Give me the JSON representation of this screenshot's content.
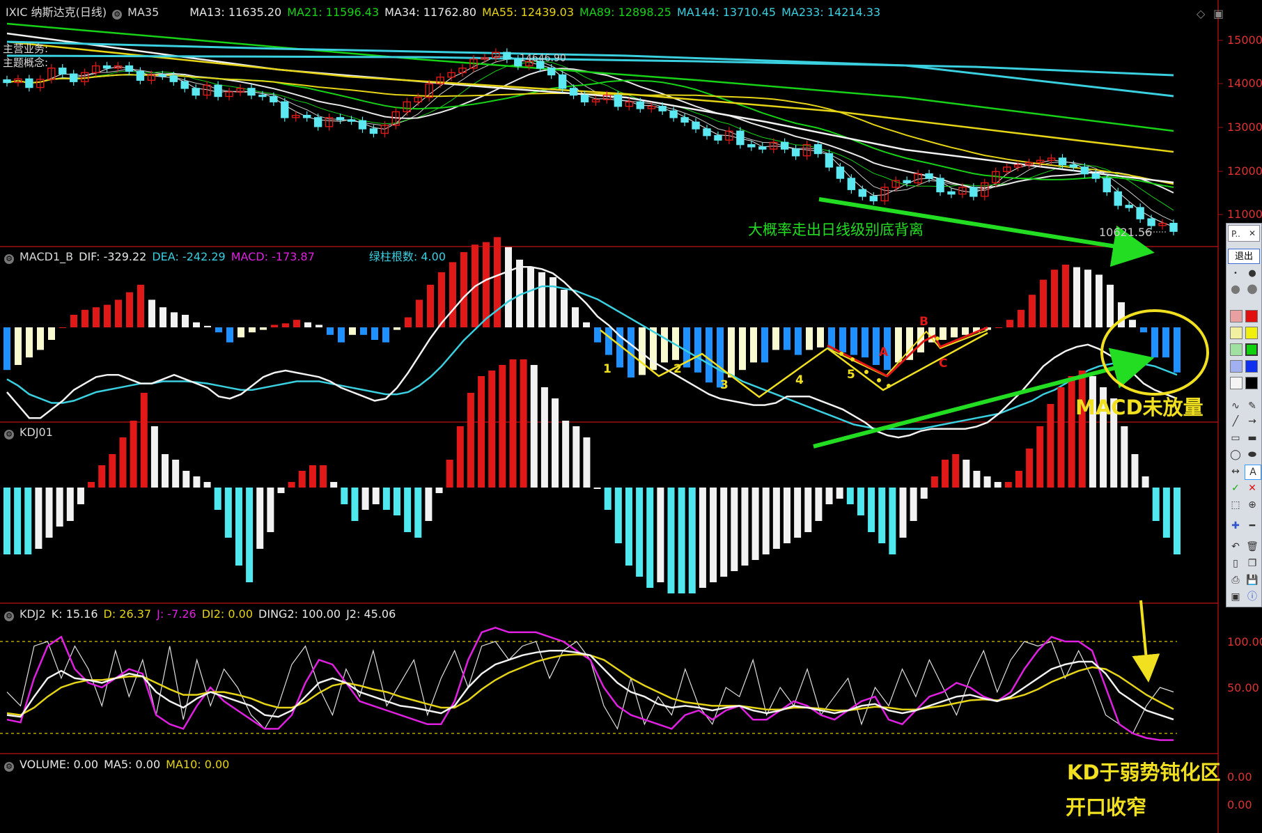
{
  "header": {
    "symbol": "IXIC 纳斯达克(日线)",
    "ma_main": "MA35",
    "ma_items": [
      {
        "label": "MA13: 11635.20",
        "color": "#e8e8e8"
      },
      {
        "label": "MA21: 11596.43",
        "color": "#17d217"
      },
      {
        "label": "MA34: 11762.80",
        "color": "#e8e8e8"
      },
      {
        "label": "MA55: 12439.03",
        "color": "#e6d417"
      },
      {
        "label": "MA89: 12898.25",
        "color": "#17d217"
      },
      {
        "label": "MA144: 13710.45",
        "color": "#3ad0e0"
      },
      {
        "label": "MA233: 14214.33",
        "color": "#3ad0e0"
      }
    ],
    "main_business": "主营业务:",
    "main_concept": "主题概念:",
    "peak_label": "14646.90",
    "last_price": "10621.56"
  },
  "macd_header": {
    "name": "MACD1_B",
    "items": [
      {
        "label": "DIF: -329.22",
        "color": "#e8e8e8"
      },
      {
        "label": "DEA: -242.29",
        "color": "#3ad0e0"
      },
      {
        "label": "MACD: -173.87",
        "color": "#e020e0"
      },
      {
        "label": "绿柱根数: 4.00",
        "color": "#3ad0e0"
      }
    ]
  },
  "kdj_header": {
    "name": "KDJ01"
  },
  "kdj2_header": {
    "name": "KDJ2",
    "items": [
      {
        "label": "K: 15.16",
        "color": "#e8e8e8"
      },
      {
        "label": "D: 26.37",
        "color": "#e6d417"
      },
      {
        "label": "J: -7.26",
        "color": "#e020e0"
      },
      {
        "label": "DI2: 0.00",
        "color": "#e6d417"
      },
      {
        "label": "DING2: 100.00",
        "color": "#e8e8e8"
      },
      {
        "label": "J2: 45.06",
        "color": "#e8e8e8"
      }
    ]
  },
  "volume_header": {
    "name": "VOLUME",
    "items": [
      {
        "label": "VOLUME: 0.00",
        "color": "#e8e8e8"
      },
      {
        "label": "MA5: 0.00",
        "color": "#e8e8e8"
      },
      {
        "label": "MA10: 0.00",
        "color": "#e6d417"
      }
    ]
  },
  "price_axis": [
    "15000",
    "14000",
    "13000",
    "12000",
    "11000"
  ],
  "kdj_axis": [
    "100.00",
    "50.00"
  ],
  "volume_axis": [
    "0.00",
    "0.00"
  ],
  "annotations": {
    "bottom_divergence": "大概率走出日线级别底背离",
    "macd_no_volume": "MACD未放量",
    "kd_weak_line1_bold": "KD",
    "kd_weak_line1_rest": "于弱势钝化区",
    "kd_weak_line2": "开口收窄",
    "wave_labels": [
      "1",
      "2",
      "3",
      "4",
      "5",
      "A",
      "B",
      "C"
    ]
  },
  "toolbar": {
    "title": "P..",
    "exit": "退出"
  },
  "colors": {
    "up": "#e01818",
    "down_price": "#5ce8f0",
    "macd_blue": "#1e90ff",
    "kdj_cyan": "#4ee8ee",
    "white_bar": "#f2f2f2",
    "cream_bar": "#fafad0",
    "divider": "#a01010",
    "arrow_green": "#22dd22",
    "wave_yellow": "#f0e020"
  },
  "chart_data": [
    {
      "type": "candlestick",
      "title": "IXIC 纳斯达克(日线)",
      "ylim": [
        10500,
        15300
      ],
      "series": [
        {
          "name": "MA13"
        },
        {
          "name": "MA21"
        },
        {
          "name": "MA34"
        },
        {
          "name": "MA55"
        },
        {
          "name": "MA89"
        },
        {
          "name": "MA144"
        },
        {
          "name": "MA233"
        }
      ],
      "close": [
        13930,
        14010,
        13820,
        14000,
        14250,
        14120,
        13950,
        14150,
        14300,
        14250,
        14300,
        14180,
        13980,
        14100,
        14080,
        13950,
        13800,
        13650,
        13870,
        13620,
        13720,
        13800,
        13650,
        13620,
        13500,
        13150,
        13200,
        13150,
        12950,
        13150,
        13100,
        13080,
        12900,
        12800,
        12980,
        13280,
        13500,
        13600,
        13900,
        14050,
        14150,
        14250,
        14450,
        14480,
        14600,
        14450,
        14300,
        14400,
        14250,
        14100,
        13800,
        13650,
        13500,
        13550,
        13650,
        13400,
        13500,
        13350,
        13400,
        13300,
        13150,
        13050,
        12900,
        12750,
        12650,
        12850,
        12550,
        12500,
        12450,
        12600,
        12450,
        12300,
        12550,
        12350,
        12050,
        11800,
        11550,
        11400,
        11300,
        11600,
        11750,
        11700,
        11900,
        11800,
        11500,
        11450,
        11600,
        11400,
        11700,
        11950,
        12050,
        12100,
        12150,
        12200,
        12250,
        12100,
        12050,
        11900,
        11800,
        11500,
        11200,
        11150,
        10900,
        10750,
        10800,
        10621.56
      ],
      "ma_last": [
        11635.2,
        11596.43,
        11762.8,
        12439.03,
        12898.25,
        13710.45,
        14214.33
      ]
    },
    {
      "type": "bar",
      "title": "MACD1_B",
      "series": [
        {
          "name": "MACD"
        },
        {
          "name": "DIF"
        },
        {
          "name": "DEA"
        }
      ],
      "macd": [
        -0.85,
        -0.75,
        -0.6,
        -0.45,
        -0.25,
        0,
        0.25,
        0.35,
        0.4,
        0.45,
        0.55,
        0.7,
        0.85,
        0.55,
        0.4,
        0.3,
        0.25,
        0.1,
        0.03,
        -0.1,
        -0.3,
        -0.2,
        -0.1,
        -0.05,
        0.05,
        0.08,
        0.15,
        0.1,
        0.05,
        -0.15,
        -0.3,
        -0.15,
        -0.15,
        -0.25,
        -0.3,
        -0.05,
        0.2,
        0.55,
        0.85,
        1.1,
        1.3,
        1.5,
        1.65,
        1.7,
        1.8,
        1.6,
        1.35,
        1.2,
        1.1,
        1.0,
        0.75,
        0.4,
        0.1,
        -0.3,
        -0.55,
        -0.8,
        -1.0,
        -0.95,
        -0.85,
        -0.7,
        -0.65,
        -0.8,
        -0.9,
        -1.1,
        -1.2,
        -1.0,
        -0.85,
        -0.7,
        -0.7,
        -0.45,
        -0.45,
        -0.55,
        -0.45,
        -0.4,
        -0.45,
        -0.5,
        -0.55,
        -0.6,
        -0.75,
        -0.85,
        -0.7,
        -0.65,
        -0.5,
        -0.3,
        -0.25,
        -0.2,
        -0.15,
        -0.1,
        -0.05,
        0.0,
        0.15,
        0.35,
        0.65,
        0.95,
        1.15,
        1.25,
        1.2,
        1.15,
        1.05,
        0.85,
        0.5,
        0.15,
        -0.1,
        -0.6,
        -0.6,
        -0.9
      ],
      "dif": [
        -1.5,
        -1.8,
        -2.1,
        -2.1,
        -1.9,
        -1.7,
        -1.45,
        -1.3,
        -1.15,
        -1.1,
        -1.1,
        -1.2,
        -1.3,
        -1.3,
        -1.2,
        -1.1,
        -1.2,
        -1.3,
        -1.4,
        -1.6,
        -1.65,
        -1.55,
        -1.35,
        -1.15,
        -1.05,
        -1.0,
        -1.05,
        -1.1,
        -1.15,
        -1.25,
        -1.4,
        -1.5,
        -1.6,
        -1.7,
        -1.65,
        -1.4,
        -1.05,
        -0.65,
        -0.25,
        0.1,
        0.4,
        0.7,
        0.95,
        1.1,
        1.2,
        1.3,
        1.4,
        1.4,
        1.35,
        1.25,
        1.05,
        0.8,
        0.55,
        0.25,
        0.05,
        -0.2,
        -0.4,
        -0.6,
        -0.8,
        -0.95,
        -1.1,
        -1.25,
        -1.4,
        -1.55,
        -1.65,
        -1.7,
        -1.75,
        -1.8,
        -1.8,
        -1.75,
        -1.6,
        -1.6,
        -1.6,
        -1.7,
        -1.8,
        -1.9,
        -2.05,
        -2.2,
        -2.4,
        -2.5,
        -2.55,
        -2.5,
        -2.4,
        -2.35,
        -2.35,
        -2.35,
        -2.35,
        -2.3,
        -2.2,
        -2.0,
        -1.75,
        -1.5,
        -1.2,
        -0.9,
        -0.7,
        -0.55,
        -0.45,
        -0.4,
        -0.5,
        -0.65,
        -0.85,
        -1.05,
        -1.3,
        -1.45,
        -1.55,
        -1.65
      ],
      "dea": [
        -1.2,
        -1.35,
        -1.55,
        -1.65,
        -1.75,
        -1.75,
        -1.7,
        -1.6,
        -1.5,
        -1.45,
        -1.4,
        -1.35,
        -1.3,
        -1.3,
        -1.25,
        -1.25,
        -1.25,
        -1.27,
        -1.3,
        -1.35,
        -1.4,
        -1.45,
        -1.45,
        -1.4,
        -1.35,
        -1.3,
        -1.25,
        -1.25,
        -1.25,
        -1.3,
        -1.35,
        -1.4,
        -1.45,
        -1.5,
        -1.55,
        -1.55,
        -1.5,
        -1.35,
        -1.15,
        -0.9,
        -0.6,
        -0.3,
        -0.05,
        0.2,
        0.4,
        0.6,
        0.75,
        0.85,
        0.95,
        0.95,
        0.9,
        0.85,
        0.75,
        0.65,
        0.5,
        0.35,
        0.2,
        0.05,
        -0.1,
        -0.25,
        -0.4,
        -0.55,
        -0.7,
        -0.85,
        -1.0,
        -1.1,
        -1.25,
        -1.35,
        -1.45,
        -1.55,
        -1.65,
        -1.75,
        -1.85,
        -1.95,
        -2.05,
        -2.15,
        -2.25,
        -2.3,
        -2.35,
        -2.35,
        -2.35,
        -2.35,
        -2.35,
        -2.3,
        -2.25,
        -2.2,
        -2.15,
        -2.1,
        -2.05,
        -2.0,
        -1.9,
        -1.8,
        -1.7,
        -1.55,
        -1.45,
        -1.3,
        -1.15,
        -1.0,
        -0.9,
        -0.85,
        -0.8,
        -0.8,
        -0.85,
        -0.9,
        -1.0,
        -1.1
      ]
    },
    {
      "type": "bar",
      "title": "KDJ01",
      "values": [
        -0.6,
        -0.6,
        -0.6,
        -0.55,
        -0.45,
        -0.35,
        -0.3,
        -0.15,
        0.05,
        0.2,
        0.3,
        0.45,
        0.6,
        0.85,
        0.55,
        0.3,
        0.25,
        0.15,
        0.1,
        0.05,
        -0.2,
        -0.45,
        -0.7,
        -0.85,
        -0.55,
        -0.4,
        -0.05,
        0.05,
        0.15,
        0.2,
        0.2,
        0.05,
        -0.15,
        -0.3,
        -0.2,
        -0.15,
        -0.2,
        -0.25,
        -0.4,
        -0.45,
        -0.3,
        -0.05,
        0.25,
        0.55,
        0.85,
        1.0,
        1.05,
        1.1,
        1.15,
        1.15,
        1.1,
        0.9,
        0.8,
        0.6,
        0.55,
        0.45,
        0.0,
        -0.2,
        -0.5,
        -0.7,
        -0.8,
        -0.9,
        -0.85,
        -0.95,
        -0.95,
        -0.95,
        -0.9,
        -0.85,
        -0.8,
        -0.75,
        -0.7,
        -0.65,
        -0.6,
        -0.55,
        -0.5,
        -0.45,
        -0.4,
        -0.3,
        -0.15,
        -0.1,
        -0.15,
        -0.25,
        -0.4,
        -0.5,
        -0.6,
        -0.45,
        -0.3,
        -0.1,
        0.1,
        0.25,
        0.3,
        0.25,
        0.15,
        0.1,
        0.05,
        0.05,
        0.15,
        0.35,
        0.55,
        0.75,
        0.9,
        1.0,
        1.05,
        1.0,
        0.9,
        0.8,
        0.55,
        0.3,
        0.1,
        -0.3,
        -0.45,
        -0.6
      ],
      "colors_code": "r=red,w=white,c=cyan"
    },
    {
      "type": "line",
      "title": "KDJ2",
      "ylim": [
        -20,
        120
      ],
      "series": [
        {
          "name": "K"
        },
        {
          "name": "D"
        },
        {
          "name": "J"
        },
        {
          "name": "J2"
        }
      ],
      "k": [
        20,
        18,
        40,
        60,
        68,
        60,
        58,
        55,
        60,
        65,
        62,
        45,
        35,
        28,
        38,
        45,
        40,
        35,
        30,
        20,
        18,
        25,
        40,
        55,
        60,
        55,
        45,
        40,
        35,
        30,
        28,
        25,
        22,
        30,
        50,
        65,
        75,
        80,
        85,
        88,
        90,
        90,
        88,
        85,
        70,
        55,
        45,
        40,
        32,
        28,
        30,
        28,
        25,
        28,
        30,
        25,
        22,
        25,
        30,
        28,
        25,
        22,
        25,
        30,
        32,
        25,
        22,
        25,
        30,
        35,
        40,
        42,
        38,
        35,
        40,
        50,
        60,
        70,
        75,
        78,
        78,
        65,
        45,
        35,
        25,
        20,
        15.16
      ],
      "d": [
        22,
        20,
        28,
        40,
        50,
        55,
        58,
        58,
        60,
        62,
        62,
        55,
        48,
        42,
        42,
        45,
        45,
        42,
        38,
        32,
        28,
        28,
        34,
        44,
        52,
        55,
        52,
        48,
        45,
        40,
        36,
        32,
        28,
        28,
        36,
        48,
        58,
        66,
        72,
        78,
        82,
        85,
        86,
        85,
        80,
        70,
        60,
        52,
        45,
        38,
        34,
        32,
        30,
        30,
        30,
        28,
        26,
        26,
        28,
        28,
        27,
        25,
        25,
        27,
        29,
        28,
        26,
        26,
        28,
        30,
        33,
        36,
        37,
        36,
        38,
        42,
        48,
        56,
        62,
        68,
        72,
        70,
        62,
        52,
        42,
        34,
        26.37
      ],
      "j": [
        15,
        12,
        60,
        95,
        105,
        70,
        55,
        50,
        60,
        70,
        65,
        20,
        10,
        5,
        30,
        50,
        35,
        25,
        15,
        5,
        5,
        20,
        55,
        80,
        75,
        55,
        35,
        30,
        25,
        20,
        15,
        10,
        10,
        35,
        80,
        110,
        115,
        110,
        110,
        110,
        105,
        100,
        90,
        80,
        50,
        30,
        20,
        15,
        10,
        5,
        20,
        25,
        15,
        25,
        30,
        15,
        15,
        25,
        35,
        30,
        20,
        15,
        25,
        35,
        40,
        15,
        10,
        25,
        40,
        45,
        55,
        50,
        40,
        35,
        45,
        70,
        90,
        105,
        100,
        100,
        90,
        50,
        10,
        0,
        -5,
        -7.26,
        -7.26
      ],
      "j2": [
        45,
        30,
        95,
        100,
        60,
        95,
        70,
        30,
        90,
        40,
        80,
        20,
        95,
        15,
        80,
        30,
        70,
        50,
        20,
        5,
        30,
        75,
        95,
        50,
        20,
        70,
        40,
        90,
        30,
        55,
        80,
        20,
        60,
        90,
        50,
        95,
        100,
        80,
        95,
        100,
        60,
        90,
        100,
        80,
        30,
        5,
        60,
        10,
        40,
        20,
        70,
        30,
        10,
        50,
        40,
        80,
        20,
        50,
        30,
        70,
        20,
        40,
        60,
        10,
        50,
        30,
        70,
        40,
        80,
        50,
        20,
        60,
        90,
        45,
        80,
        100,
        95,
        100,
        60,
        90,
        60,
        20,
        10,
        0,
        30,
        50,
        45.06
      ]
    },
    {
      "type": "bar",
      "title": "VOLUME",
      "values": [
        0
      ]
    }
  ]
}
